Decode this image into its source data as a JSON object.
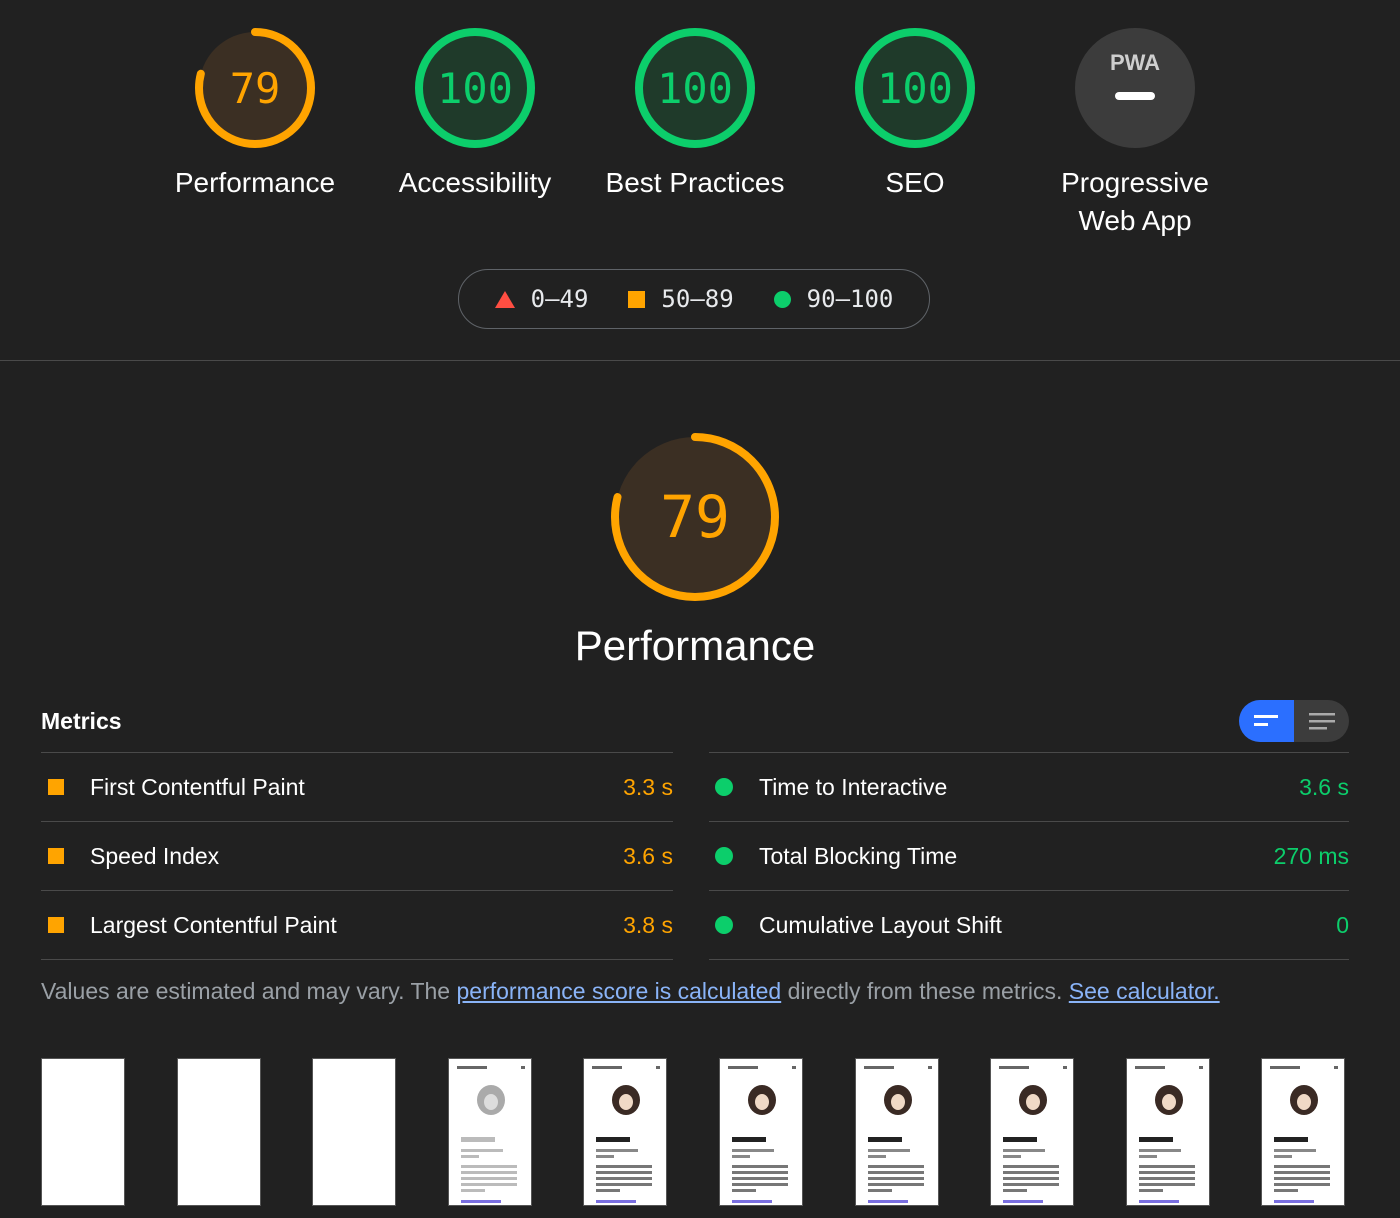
{
  "categories": [
    {
      "score": "79",
      "label": "Performance",
      "rating": "average",
      "fraction": 0.79
    },
    {
      "score": "100",
      "label": "Accessibility",
      "rating": "pass",
      "fraction": 1.0
    },
    {
      "score": "100",
      "label": "Best Practices",
      "rating": "pass",
      "fraction": 1.0
    },
    {
      "score": "100",
      "label": "SEO",
      "rating": "pass",
      "fraction": 1.0
    },
    {
      "label_line1": "Progressive",
      "label_line2": "Web App",
      "badge": "PWA",
      "rating": "na"
    }
  ],
  "legend": [
    {
      "range": "0–49",
      "shape": "triangle",
      "color": "#ff4e42"
    },
    {
      "range": "50–89",
      "shape": "square",
      "color": "#ffa400"
    },
    {
      "range": "90–100",
      "shape": "circle",
      "color": "#0cce6b"
    }
  ],
  "performance": {
    "score": "79",
    "fraction": 0.79,
    "title": "Performance"
  },
  "metrics": {
    "header": "Metrics",
    "left": [
      {
        "name": "First Contentful Paint",
        "value": "3.3 s",
        "rating": "average"
      },
      {
        "name": "Speed Index",
        "value": "3.6 s",
        "rating": "average"
      },
      {
        "name": "Largest Contentful Paint",
        "value": "3.8 s",
        "rating": "average"
      }
    ],
    "right": [
      {
        "name": "Time to Interactive",
        "value": "3.6 s",
        "rating": "pass"
      },
      {
        "name": "Total Blocking Time",
        "value": "270 ms",
        "rating": "pass"
      },
      {
        "name": "Cumulative Layout Shift",
        "value": "0",
        "rating": "pass"
      }
    ]
  },
  "note": {
    "prefix": "Values are estimated and may vary. The ",
    "link1": "performance score is calculated",
    "middle": " directly from these metrics. ",
    "link2": "See calculator."
  },
  "filmstrip": {
    "frames": [
      "blank",
      "blank",
      "blank",
      "faded",
      "loaded",
      "loaded",
      "loaded",
      "loaded",
      "loaded",
      "loaded"
    ]
  },
  "colors": {
    "average": "#ffa400",
    "pass": "#0cce6b",
    "fail": "#ff4e42",
    "accent": "#2b6fff",
    "link": "#8ab4f8"
  }
}
